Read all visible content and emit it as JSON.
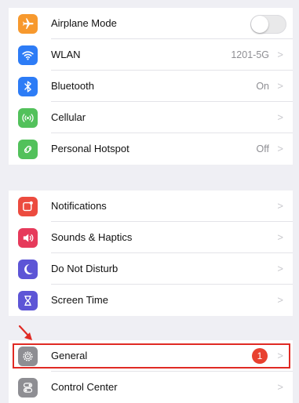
{
  "sections": [
    {
      "items": [
        {
          "label": "Airplane Mode",
          "icon": "airplane-icon",
          "color": "#f7992e",
          "control": "toggle",
          "toggle_on": false
        },
        {
          "label": "WLAN",
          "icon": "wifi-icon",
          "color": "#2d7cf6",
          "value": "1201-5G",
          "chevron": ">"
        },
        {
          "label": "Bluetooth",
          "icon": "bluetooth-icon",
          "color": "#2d7cf6",
          "value": "On",
          "chevron": ">"
        },
        {
          "label": "Cellular",
          "icon": "cellular-icon",
          "color": "#52c15b",
          "chevron": ">"
        },
        {
          "label": "Personal Hotspot",
          "icon": "hotspot-icon",
          "color": "#52c15b",
          "value": "Off",
          "chevron": ">"
        }
      ]
    },
    {
      "items": [
        {
          "label": "Notifications",
          "icon": "notifications-icon",
          "color": "#ec4b3f",
          "chevron": ">"
        },
        {
          "label": "Sounds & Haptics",
          "icon": "speaker-icon",
          "color": "#e63a5b",
          "chevron": ">"
        },
        {
          "label": "Do Not Disturb",
          "icon": "moon-icon",
          "color": "#5d55d6",
          "chevron": ">"
        },
        {
          "label": "Screen Time",
          "icon": "hourglass-icon",
          "color": "#5d55d6",
          "chevron": ">"
        }
      ]
    },
    {
      "items": [
        {
          "label": "General",
          "icon": "gear-icon",
          "color": "#8e8e93",
          "badge": "1",
          "chevron": ">",
          "highlighted": true
        },
        {
          "label": "Control Center",
          "icon": "control-center-icon",
          "color": "#8e8e93",
          "chevron": ">"
        }
      ]
    }
  ],
  "annotation": {
    "highlight_color": "#e02a24"
  }
}
